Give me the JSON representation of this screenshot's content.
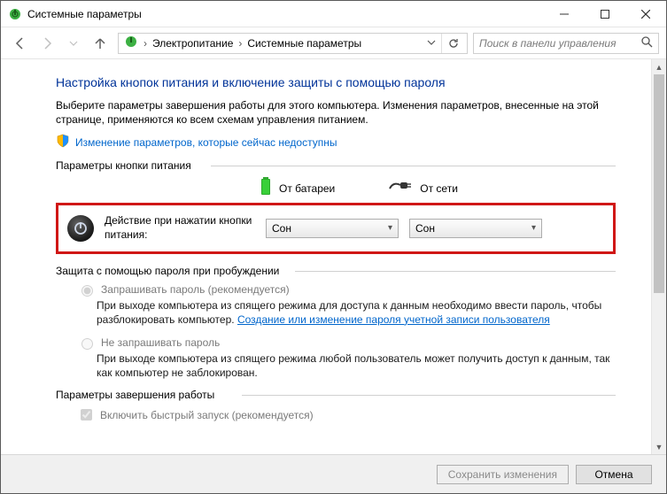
{
  "titlebar": {
    "title": "Системные параметры"
  },
  "nav": {
    "crumb1": "Электропитание",
    "crumb2": "Системные параметры",
    "search_placeholder": "Поиск в панели управления"
  },
  "page": {
    "heading": "Настройка кнопок питания и включение защиты с помощью пароля",
    "desc": "Выберите параметры завершения работы для этого компьютера. Изменения параметров, внесенные на этой странице, применяются ко всем схемам управления питанием.",
    "change_locked_link": "Изменение параметров, которые сейчас недоступны"
  },
  "sections": {
    "power_button": "Параметры кнопки питания",
    "password": "Защита с помощью пароля при пробуждении",
    "shutdown": "Параметры завершения работы"
  },
  "columns": {
    "battery": "От батареи",
    "ac": "От сети"
  },
  "action": {
    "label": "Действие при нажатии кнопки питания:",
    "battery_value": "Сон",
    "ac_value": "Сон"
  },
  "password": {
    "opt1_label": "Запрашивать пароль (рекомендуется)",
    "opt1_desc_a": "При выходе компьютера из спящего режима для доступа к данным необходимо ввести пароль, чтобы разблокировать компьютер. ",
    "opt1_link": "Создание или изменение пароля учетной записи пользователя",
    "opt2_label": "Не запрашивать пароль",
    "opt2_desc": "При выходе компьютера из спящего режима любой пользователь может получить доступ к данным, так как компьютер не заблокирован."
  },
  "shutdown": {
    "fast_label": "Включить быстрый запуск (рекомендуется)"
  },
  "footer": {
    "save": "Сохранить изменения",
    "cancel": "Отмена"
  }
}
